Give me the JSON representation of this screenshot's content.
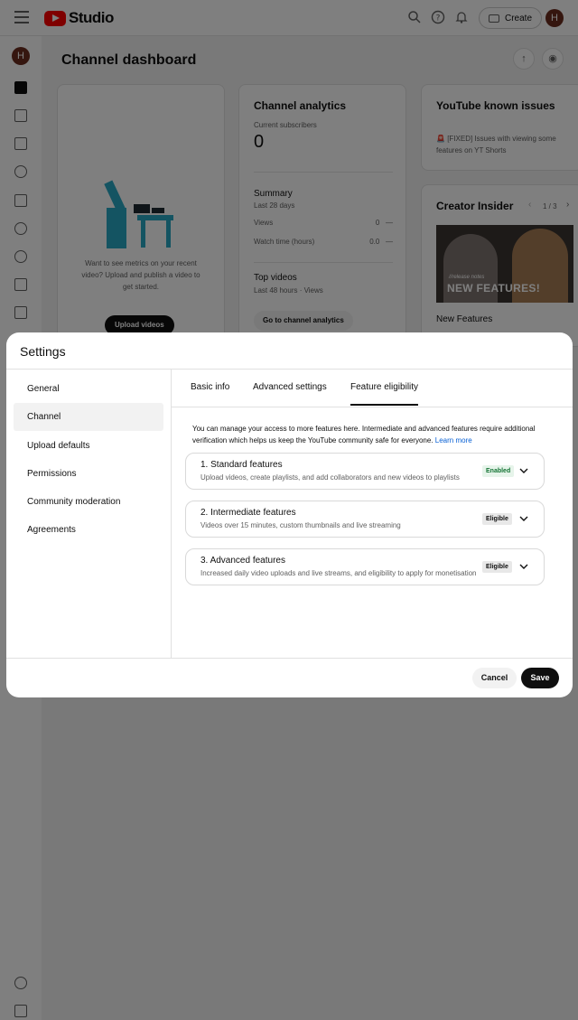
{
  "app": {
    "logo_text": "Studio",
    "create_label": "Create",
    "avatar_initial": "H"
  },
  "dashboard": {
    "title": "Channel dashboard",
    "upload_card": {
      "message": "Want to see metrics on your recent video? Upload and publish a video to get started.",
      "button": "Upload videos"
    },
    "analytics_card": {
      "title": "Channel analytics",
      "subscribers_label": "Current subscribers",
      "subscribers_value": "0",
      "summary_title": "Summary",
      "summary_period": "Last 28 days",
      "rows": [
        {
          "label": "Views",
          "value": "0",
          "trend": "—"
        },
        {
          "label": "Watch time (hours)",
          "value": "0.0",
          "trend": "—"
        }
      ],
      "top_videos_title": "Top videos",
      "top_videos_period": "Last 48 hours · Views",
      "button": "Go to channel analytics"
    },
    "issues_card": {
      "title": "YouTube known issues",
      "text": "[FIXED] Issues with viewing some features on YT Shorts"
    },
    "insider_card": {
      "title": "Creator Insider",
      "pager": "1 / 3",
      "thumb_small": "//release notes",
      "thumb_big": "NEW FEATURES!",
      "caption": "New Features"
    }
  },
  "settings": {
    "title": "Settings",
    "nav": [
      "General",
      "Channel",
      "Upload defaults",
      "Permissions",
      "Community moderation",
      "Agreements"
    ],
    "active_nav": "Channel",
    "tabs": [
      "Basic info",
      "Advanced settings",
      "Feature eligibility"
    ],
    "active_tab": "Feature eligibility",
    "intro": "You can manage your access to more features here. Intermediate and advanced features require additional verification which helps us keep the YouTube community safe for everyone.",
    "learn_more": "Learn more",
    "features": [
      {
        "title": "1. Standard features",
        "description": "Upload videos, create playlists, and add collaborators and new videos to playlists",
        "status": "Enabled"
      },
      {
        "title": "2. Intermediate features",
        "description": "Videos over 15 minutes, custom thumbnails and live streaming",
        "status": "Eligible"
      },
      {
        "title": "3. Advanced features",
        "description": "Increased daily video uploads and live streams, and eligibility to apply for monetisation",
        "status": "Eligible"
      }
    ],
    "cancel_label": "Cancel",
    "save_label": "Save"
  }
}
